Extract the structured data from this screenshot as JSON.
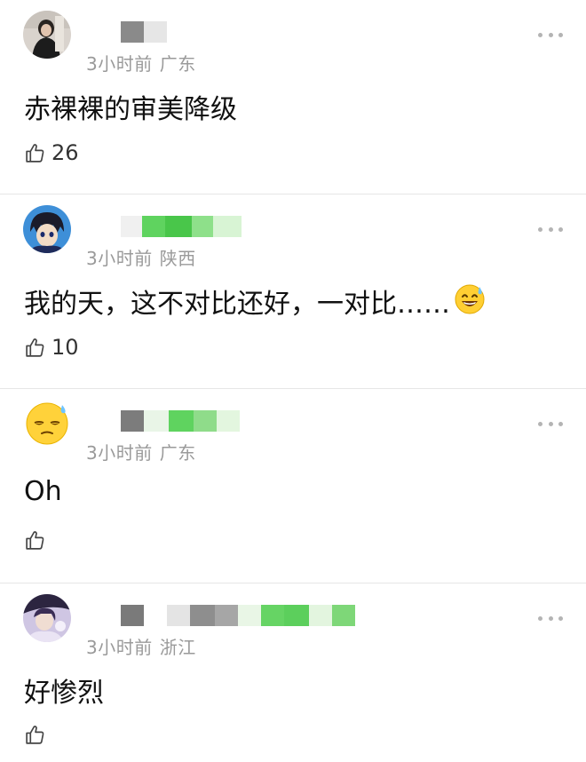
{
  "comments": [
    {
      "time": "3小时前",
      "location": "广东",
      "text": "赤裸裸的审美降级",
      "likes": "26",
      "avatar": "photo-avatar"
    },
    {
      "time": "3小时前",
      "location": "陕西",
      "text": "我的天，这不对比还好，一对比……",
      "emoji": "sweat-smile-emoji",
      "likes": "10",
      "avatar": "anime-avatar"
    },
    {
      "time": "3小时前",
      "location": "广东",
      "text": "Oh",
      "likes": "",
      "avatar": "emoji-avatar"
    },
    {
      "time": "3小时前",
      "location": "浙江",
      "text": "好惨烈",
      "likes": "",
      "avatar": "photo-avatar"
    }
  ],
  "icons": {
    "like": "thumbs-up-icon",
    "more": "more-dots-icon"
  },
  "colors": {
    "meta": "#9a9a9a",
    "censor_green": "#5fd35f",
    "censor_gray": "#8a8a8a"
  }
}
